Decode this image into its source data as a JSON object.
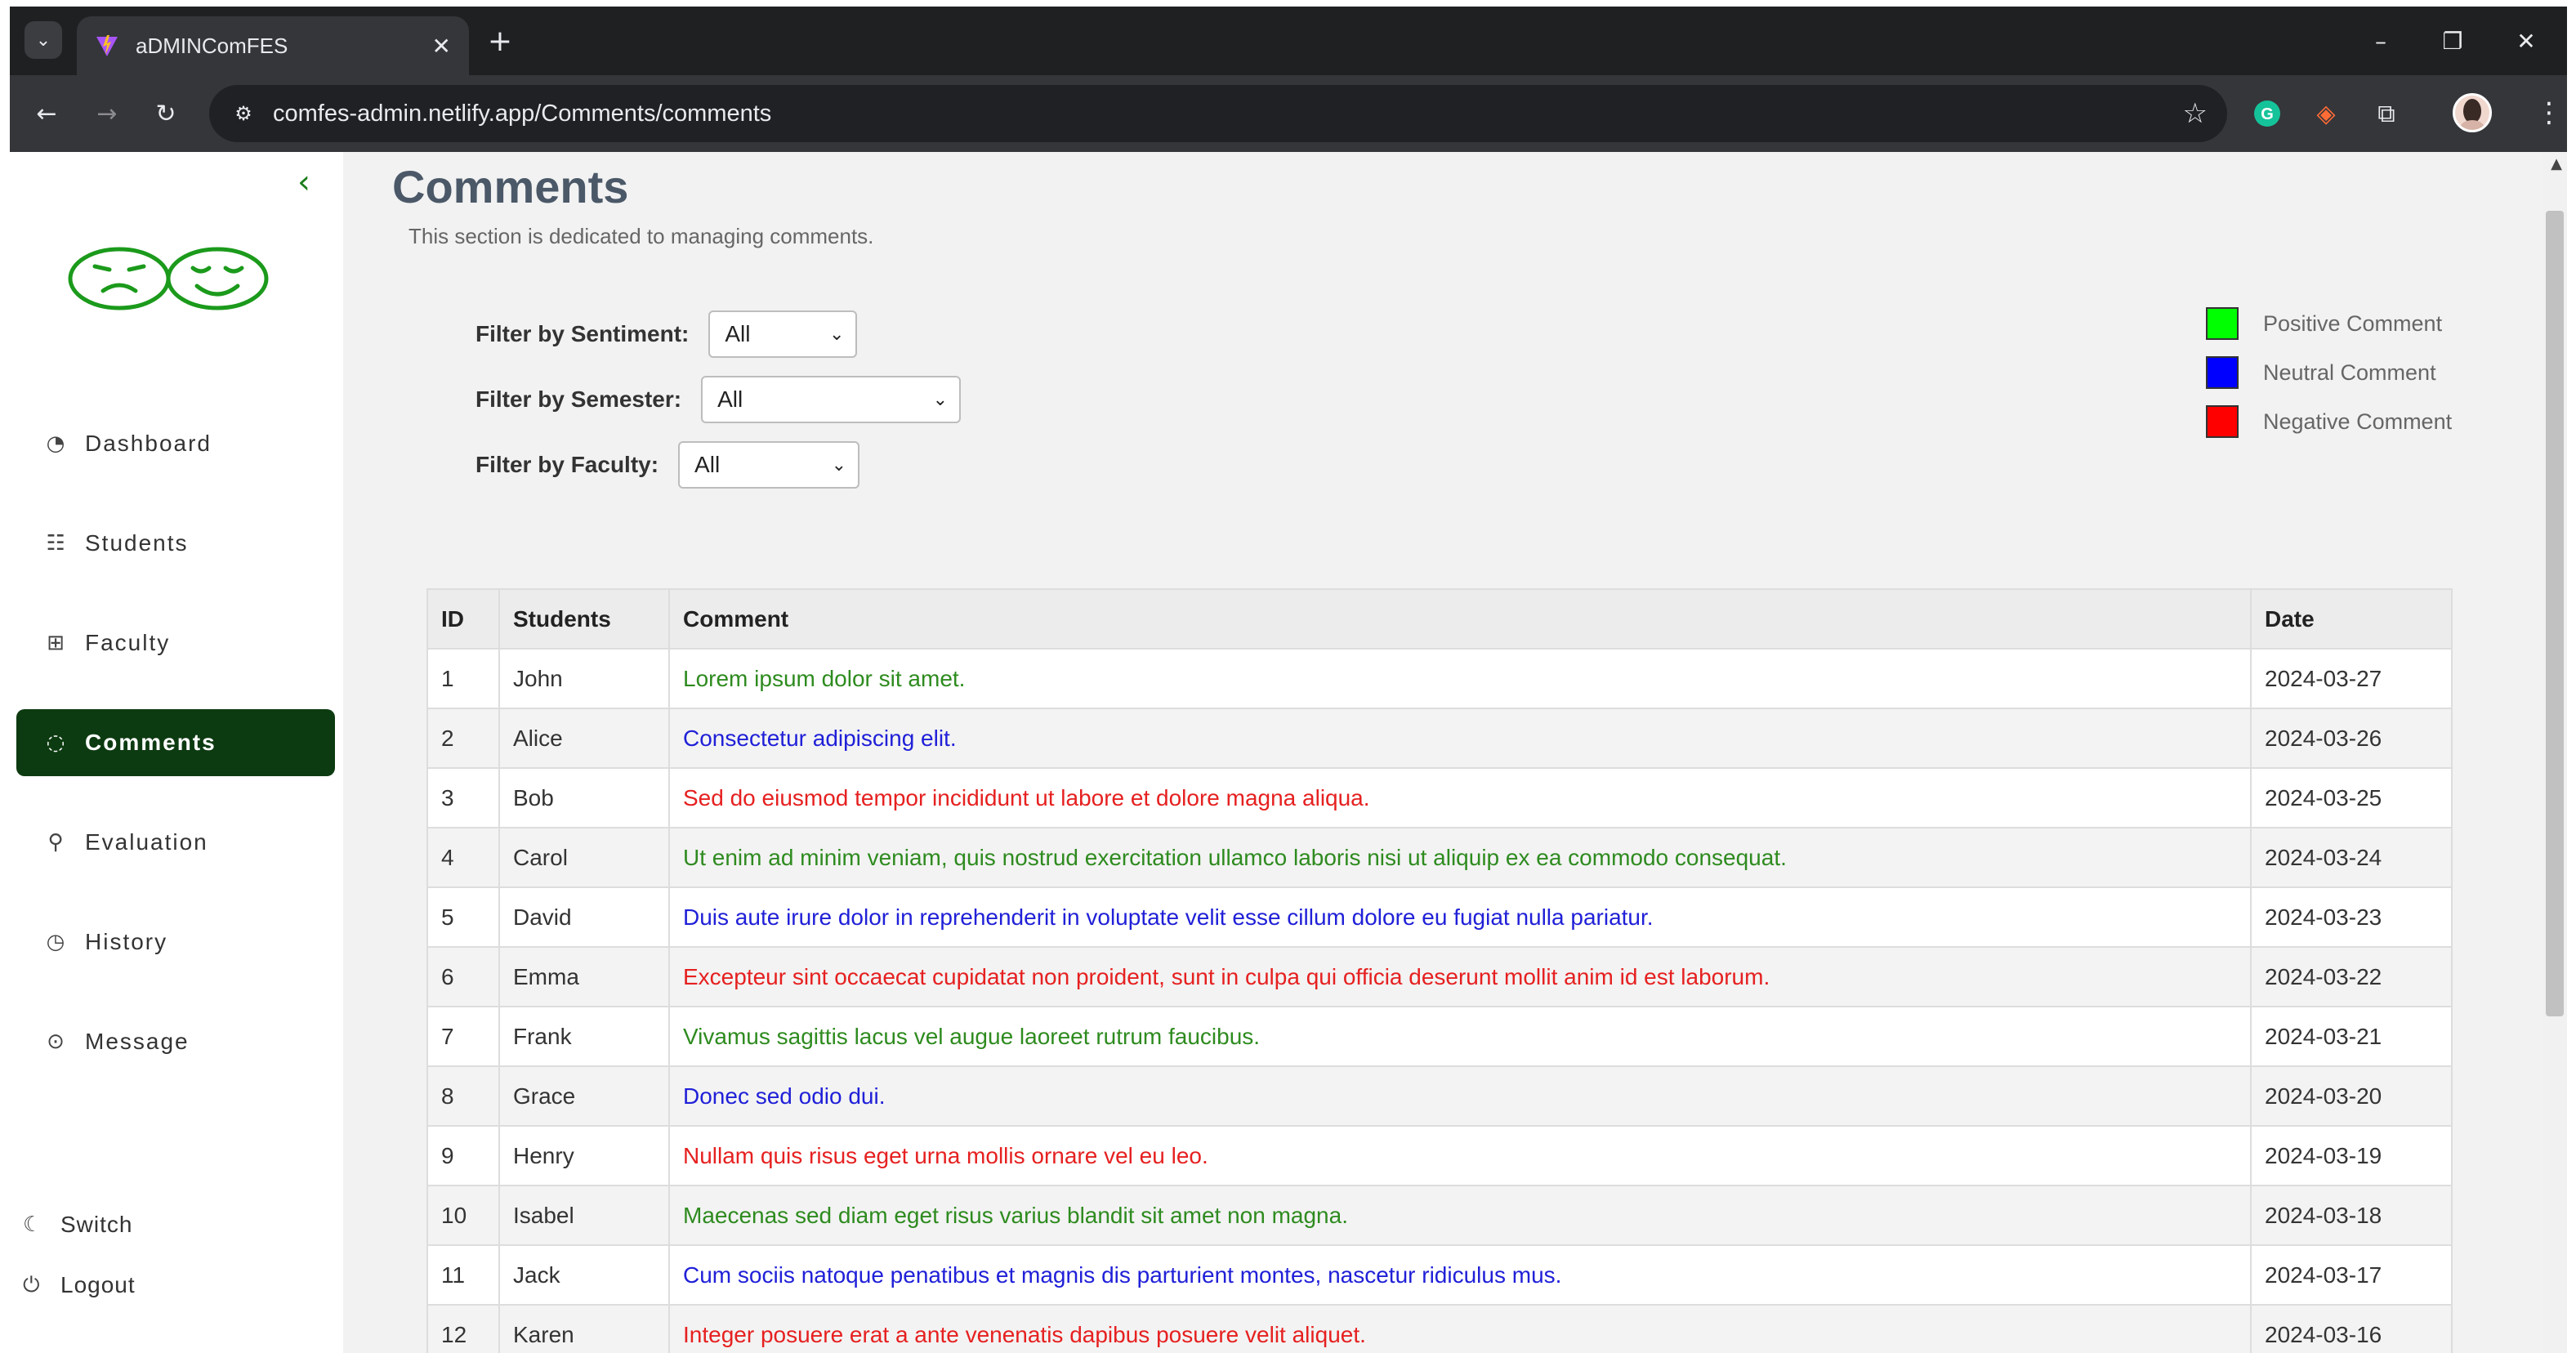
{
  "browser": {
    "tab_title": "aDMINComFES",
    "url": "comfes-admin.netlify.app/Comments/comments"
  },
  "sidebar": {
    "items": [
      {
        "label": "Dashboard",
        "icon": "gauge-icon"
      },
      {
        "label": "Students",
        "icon": "list-icon"
      },
      {
        "label": "Faculty",
        "icon": "grid-icon"
      },
      {
        "label": "Comments",
        "icon": "chat-icon",
        "active": true
      },
      {
        "label": "Evaluation",
        "icon": "person-search-icon"
      },
      {
        "label": "History",
        "icon": "history-icon"
      },
      {
        "label": "Message",
        "icon": "message-dots-icon"
      }
    ],
    "bottom": [
      {
        "label": "Switch",
        "icon": "moon-icon"
      },
      {
        "label": "Logout",
        "icon": "logout-icon"
      }
    ]
  },
  "main": {
    "title": "Comments",
    "subtitle": "This section is dedicated to managing comments.",
    "filters": [
      {
        "label": "Filter by Sentiment:",
        "value": "All"
      },
      {
        "label": "Filter by Semester:",
        "value": "All"
      },
      {
        "label": "Filter by Faculty:",
        "value": "All"
      }
    ],
    "legend": [
      {
        "label": "Positive Comment",
        "color": "#00ff00"
      },
      {
        "label": "Neutral Comment",
        "color": "#0000ff"
      },
      {
        "label": "Negative Comment",
        "color": "#ff0000"
      }
    ],
    "table": {
      "headers": [
        "ID",
        "Students",
        "Comment",
        "Date"
      ],
      "rows": [
        {
          "id": "1",
          "student": "John",
          "comment": "Lorem ipsum dolor sit amet.",
          "sentiment": "positive",
          "date": "2024-03-27"
        },
        {
          "id": "2",
          "student": "Alice",
          "comment": "Consectetur adipiscing elit.",
          "sentiment": "neutral",
          "date": "2024-03-26"
        },
        {
          "id": "3",
          "student": "Bob",
          "comment": "Sed do eiusmod tempor incididunt ut labore et dolore magna aliqua.",
          "sentiment": "negative",
          "date": "2024-03-25"
        },
        {
          "id": "4",
          "student": "Carol",
          "comment": "Ut enim ad minim veniam, quis nostrud exercitation ullamco laboris nisi ut aliquip ex ea commodo consequat.",
          "sentiment": "positive",
          "date": "2024-03-24"
        },
        {
          "id": "5",
          "student": "David",
          "comment": "Duis aute irure dolor in reprehenderit in voluptate velit esse cillum dolore eu fugiat nulla pariatur.",
          "sentiment": "neutral",
          "date": "2024-03-23"
        },
        {
          "id": "6",
          "student": "Emma",
          "comment": "Excepteur sint occaecat cupidatat non proident, sunt in culpa qui officia deserunt mollit anim id est laborum.",
          "sentiment": "negative",
          "date": "2024-03-22"
        },
        {
          "id": "7",
          "student": "Frank",
          "comment": "Vivamus sagittis lacus vel augue laoreet rutrum faucibus.",
          "sentiment": "positive",
          "date": "2024-03-21"
        },
        {
          "id": "8",
          "student": "Grace",
          "comment": "Donec sed odio dui.",
          "sentiment": "neutral",
          "date": "2024-03-20"
        },
        {
          "id": "9",
          "student": "Henry",
          "comment": "Nullam quis risus eget urna mollis ornare vel eu leo.",
          "sentiment": "negative",
          "date": "2024-03-19"
        },
        {
          "id": "10",
          "student": "Isabel",
          "comment": "Maecenas sed diam eget risus varius blandit sit amet non magna.",
          "sentiment": "positive",
          "date": "2024-03-18"
        },
        {
          "id": "11",
          "student": "Jack",
          "comment": "Cum sociis natoque penatibus et magnis dis parturient montes, nascetur ridiculus mus.",
          "sentiment": "neutral",
          "date": "2024-03-17"
        },
        {
          "id": "12",
          "student": "Karen",
          "comment": "Integer posuere erat a ante venenatis dapibus posuere velit aliquet.",
          "sentiment": "negative",
          "date": "2024-03-16"
        }
      ]
    }
  },
  "colors": {
    "positive_text": "#2e8b1f",
    "neutral_text": "#2020d8",
    "negative_text": "#e62020",
    "sidebar_active": "#0d3b11",
    "logo": "#1b9a1b"
  }
}
